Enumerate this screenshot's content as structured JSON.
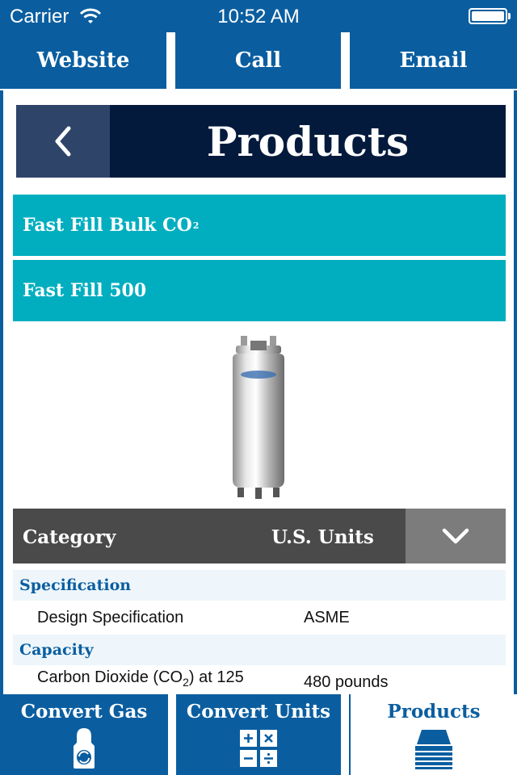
{
  "status_bar": {
    "carrier": "Carrier",
    "time": "10:52 AM"
  },
  "top_actions": {
    "website": "Website",
    "call": "Call",
    "email": "Email"
  },
  "header": {
    "title": "Products",
    "back_icon": "chevron-left-icon"
  },
  "product_rows": {
    "bulk_label": "Fast Fill Bulk CO",
    "bulk_subscript": "2",
    "model_label": "Fast Fill 500"
  },
  "product_image": {
    "icon": "cylinder-image"
  },
  "category_header": {
    "category": "Category",
    "units": "U.S. Units",
    "dropdown_icon": "chevron-down-icon"
  },
  "spec_table": {
    "specification_heading": "Specification",
    "design_spec_key": "Design Specification",
    "design_spec_value": "ASME",
    "capacity_heading": "Capacity",
    "co2_key_prefix": "Carbon Dioxide (CO",
    "co2_key_subscript": "2",
    "co2_key_suffix": ") at 125",
    "co2_value": "480 pounds"
  },
  "tab_bar": {
    "convert_gas": "Convert Gas",
    "convert_units": "Convert Units",
    "products": "Products",
    "active": "Products"
  },
  "colors": {
    "primary_blue": "#0a5ea0",
    "navy": "#041a3c",
    "teal": "#00aebf",
    "category_gray": "#4a4a4a"
  }
}
